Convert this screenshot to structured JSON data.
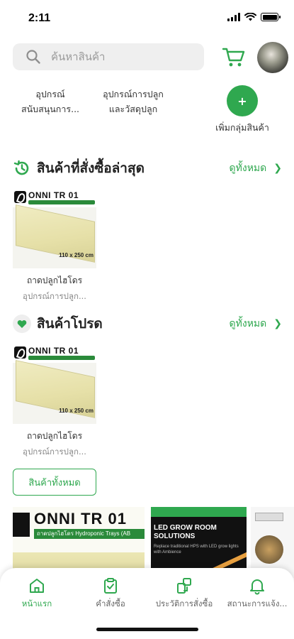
{
  "status_bar": {
    "time": "2:11"
  },
  "search": {
    "placeholder": "ค้นหาสินค้า"
  },
  "categories": [
    {
      "line1": "อุปกรณ์",
      "line2": "สนับสนุนการ..."
    },
    {
      "line1": "อุปกรณ์การปลูก",
      "line2": "และวัสดุปลูก"
    }
  ],
  "add_group": {
    "icon": "+",
    "label": "เพิ่มกลุ่มสินค้า"
  },
  "recent_section": {
    "title": "สินค้าที่สั่งซื้อล่าสุด",
    "see_all": "ดูทั้งหมด"
  },
  "favorite_section": {
    "title": "สินค้าโปรด",
    "see_all": "ดูทั้งหมด"
  },
  "recent_products": [
    {
      "brand": "ONNI TR 01",
      "size": "110 x 250 cm",
      "name": "ถาดปลูกไฮโดร",
      "category": "อุปกรณ์การปลูก..."
    }
  ],
  "favorite_products": [
    {
      "brand": "ONNI TR 01",
      "size": "110 x 250 cm",
      "name": "ถาดปลูกไฮโดร",
      "category": "อุปกรณ์การปลูก..."
    }
  ],
  "all_products_button": "สินค้าทั้งหมด",
  "banners": {
    "banner1": {
      "brand": "ONNI TR 01",
      "strip": "ถาดปลูกไฮโดร Hydroponic Trays (AB"
    },
    "banner2": {
      "title": "LED GROW ROOM SOLUTIONS",
      "subtitle": "Replace traditional HPS with LED grow lights with Ambience"
    }
  },
  "bottom_nav": [
    {
      "label": "หน้าแรก",
      "icon": "home-icon",
      "active": true
    },
    {
      "label": "คำสั่งซื้อ",
      "icon": "clipboard-check-icon",
      "active": false
    },
    {
      "label": "ประวัติการสั่งซื้อ",
      "icon": "order-history-icon",
      "active": false
    },
    {
      "label": "สถานะการแจ้ง...",
      "icon": "bell-icon",
      "active": false
    }
  ],
  "colors": {
    "accent": "#2fa84f",
    "search_bg": "#efefef"
  }
}
